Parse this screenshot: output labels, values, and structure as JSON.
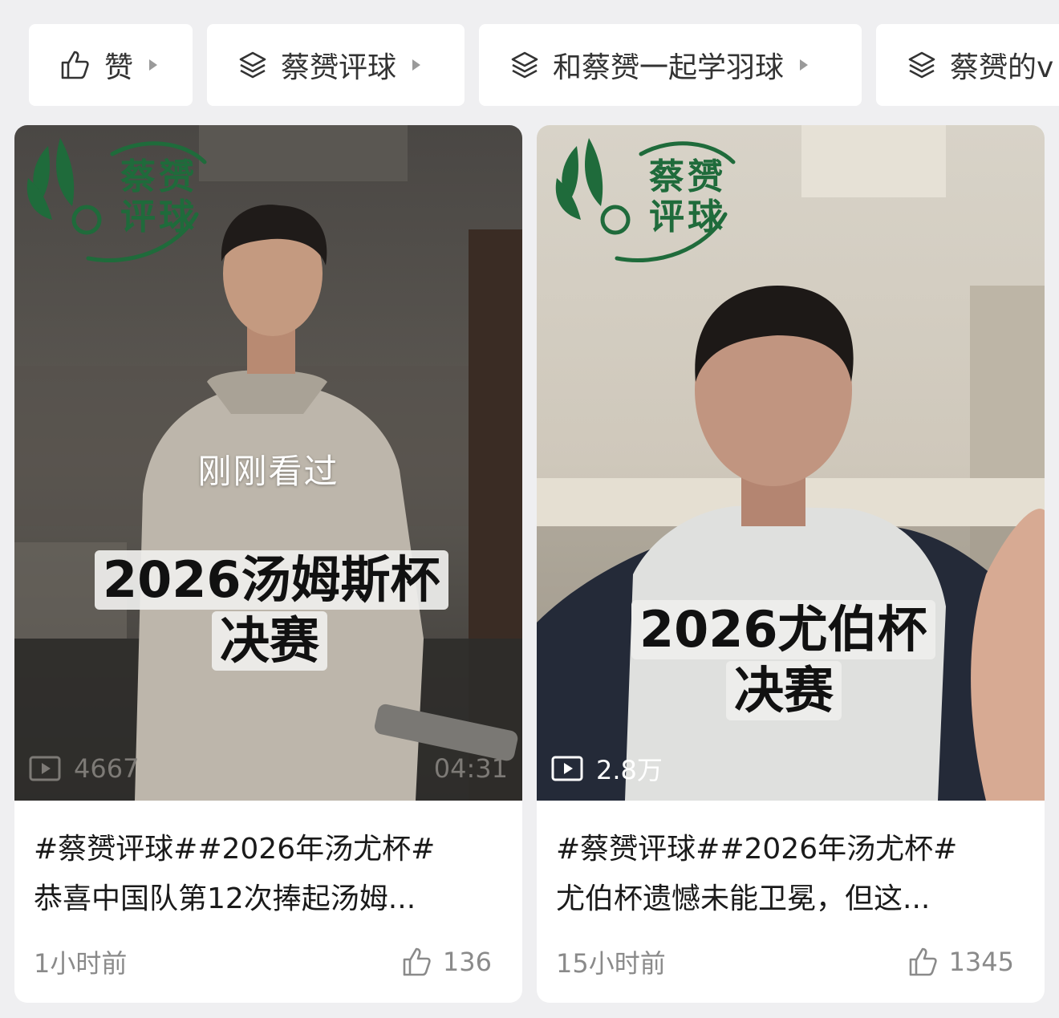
{
  "chips": [
    {
      "label": "赞",
      "icon": "thumb-up-icon"
    },
    {
      "label": "蔡赟评球",
      "icon": "layers-icon"
    },
    {
      "label": "和蔡赟一起学羽球",
      "icon": "layers-icon"
    },
    {
      "label": "蔡赟的v",
      "icon": "layers-icon"
    }
  ],
  "cards": [
    {
      "logo_text": "蔡赟评球",
      "watched_label": "刚刚看过",
      "sticker_line1": "2026汤姆斯杯",
      "sticker_line2": "决赛",
      "views": "4667",
      "duration": "04:31",
      "title_line1": "#蔡赟评球##2026年汤尤杯#",
      "title_line2": "恭喜中国队第12次捧起汤姆...",
      "time": "1小时前",
      "likes": "136"
    },
    {
      "logo_text": "蔡赟评球",
      "sticker_line1": "2026尤伯杯",
      "sticker_line2": "决赛",
      "views": "2.8万",
      "title_line1": "#蔡赟评球##2026年汤尤杯#",
      "title_line2": "尤伯杯遗憾未能卫冕，但这...",
      "time": "15小时前",
      "likes": "1345"
    }
  ],
  "colors": {
    "logo_green": "#1f6b3b",
    "page_bg": "#efeff1",
    "meta_gray": "#8a8a8a"
  }
}
